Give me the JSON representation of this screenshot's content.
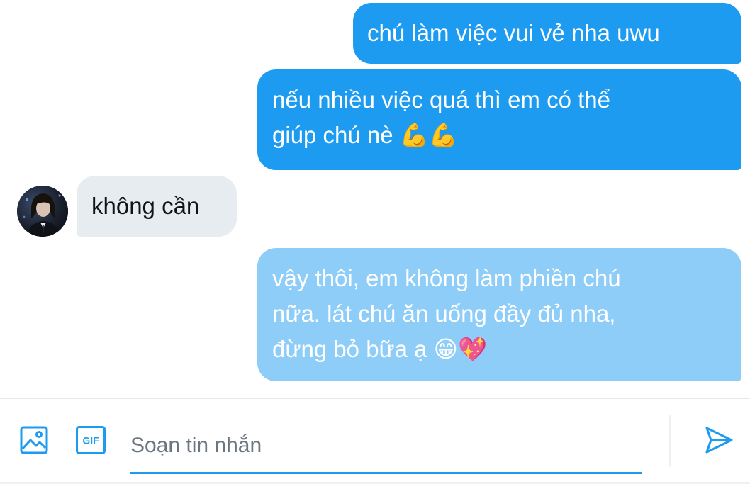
{
  "messages": [
    {
      "sender": "me",
      "lines": [
        "chú làm việc vui vẻ nha uwu"
      ]
    },
    {
      "sender": "me",
      "lines": [
        "nếu nhiều việc quá thì em có thể",
        "giúp chú nè 💪💪"
      ]
    },
    {
      "sender": "other",
      "lines": [
        "không cần"
      ]
    },
    {
      "sender": "me",
      "status": "sending",
      "lines": [
        "vậy thôi, em không làm phiền chú",
        "nữa. lát chú ăn uống đầy đủ nha,",
        "đừng bỏ bữa ạ 😁💖"
      ]
    }
  ],
  "composer": {
    "placeholder": "Soạn tin nhắn",
    "value": "",
    "media_icon": "image-icon",
    "gif_icon": "gif-icon",
    "gif_label": "GIF",
    "send_icon": "send-icon"
  },
  "colors": {
    "accent": "#1d9bf0",
    "pending_bubble": "#8ecdf8",
    "received_bubble": "#e7ecf0"
  }
}
